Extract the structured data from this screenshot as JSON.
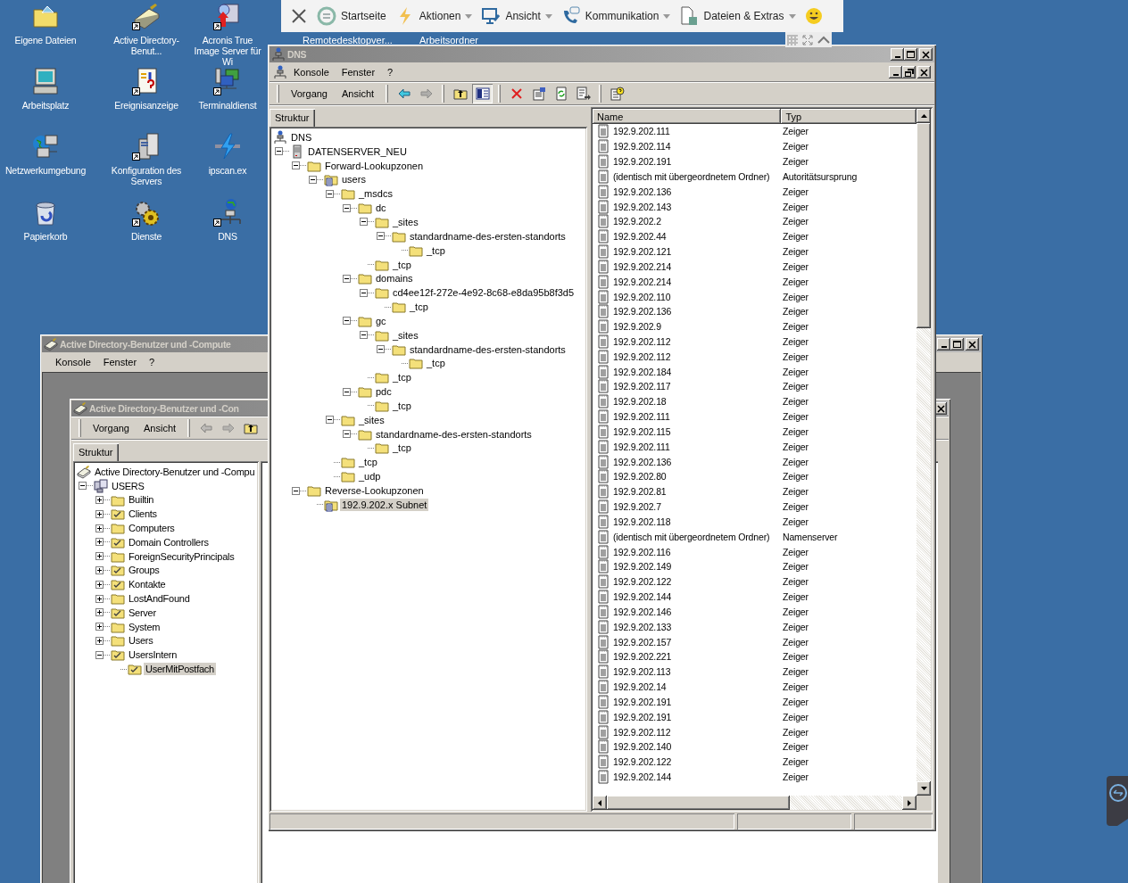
{
  "desktop_icons": [
    {
      "label": "Eigene Dateien",
      "kind": "documents",
      "shortcut": false
    },
    {
      "label": "Active Directory-Benut...",
      "kind": "directory",
      "shortcut": true
    },
    {
      "label": "Acronis True Image Server für Wi",
      "kind": "installer",
      "shortcut": true
    },
    {
      "label": "Arbeitsplatz",
      "kind": "computer",
      "shortcut": false
    },
    {
      "label": "Ereignisanzeige",
      "kind": "log",
      "shortcut": true
    },
    {
      "label": "Terminaldienst",
      "kind": "terminal",
      "shortcut": true
    },
    {
      "label": "Netzwerkumgebung",
      "kind": "network",
      "shortcut": false
    },
    {
      "label": "Konfiguration des Servers",
      "kind": "server",
      "shortcut": true
    },
    {
      "label": "ipscan.ex",
      "kind": "scanner",
      "shortcut": false
    },
    {
      "label": "Papierkorb",
      "kind": "trash",
      "shortcut": false
    },
    {
      "label": "Dienste",
      "kind": "gears",
      "shortcut": true
    },
    {
      "label": "DNS",
      "kind": "dns",
      "shortcut": true
    }
  ],
  "desktop_partial_labels": [
    "Remotedesktopver...",
    "Arbeitsordner"
  ],
  "remote_toolbar": {
    "items": [
      {
        "label": "Startseite",
        "kind": "home",
        "dropdown": false
      },
      {
        "label": "Aktionen",
        "kind": "bolt",
        "dropdown": true
      },
      {
        "label": "Ansicht",
        "kind": "monitor",
        "dropdown": true
      },
      {
        "label": "Kommunikation",
        "kind": "phone",
        "dropdown": true
      },
      {
        "label": "Dateien & Extras",
        "kind": "files",
        "dropdown": true
      }
    ]
  },
  "ad_window": {
    "title": "Active Directory-Benutzer und -Compute",
    "menu": [
      "Konsole",
      "Fenster",
      "?"
    ],
    "child": {
      "title": "Active Directory-Benutzer und -Con",
      "toolbar_menus": [
        "Vorgang",
        "Ansicht"
      ],
      "buttons": [
        {
          "kind": "back",
          "disabled": true
        },
        {
          "kind": "forward",
          "disabled": true
        },
        {
          "kind": "up",
          "disabled": false
        }
      ],
      "tab": "Struktur",
      "tree": [
        {
          "label": "Active Directory-Benutzer und -Compu",
          "kind": "directory",
          "selected": false,
          "children": [
            {
              "label": "USERS",
              "kind": "domain",
              "expanded": true,
              "selected": false,
              "children": [
                {
                  "label": "Builtin",
                  "kind": "folder",
                  "expanded": false,
                  "selected": false
                },
                {
                  "label": "Clients",
                  "kind": "ou",
                  "expanded": false,
                  "selected": false
                },
                {
                  "label": "Computers",
                  "kind": "folder",
                  "expanded": false,
                  "selected": false
                },
                {
                  "label": "Domain Controllers",
                  "kind": "ou",
                  "expanded": false,
                  "selected": false
                },
                {
                  "label": "ForeignSecurityPrincipals",
                  "kind": "folder",
                  "expanded": false,
                  "selected": false
                },
                {
                  "label": "Groups",
                  "kind": "ou",
                  "expanded": false,
                  "selected": false
                },
                {
                  "label": "Kontakte",
                  "kind": "ou",
                  "expanded": false,
                  "selected": false
                },
                {
                  "label": "LostAndFound",
                  "kind": "folder",
                  "expanded": false,
                  "selected": false
                },
                {
                  "label": "Server",
                  "kind": "ou",
                  "expanded": false,
                  "selected": false
                },
                {
                  "label": "System",
                  "kind": "folder",
                  "expanded": false,
                  "selected": false
                },
                {
                  "label": "Users",
                  "kind": "folder",
                  "expanded": false,
                  "selected": false
                },
                {
                  "label": "UsersIntern",
                  "kind": "ou",
                  "expanded": true,
                  "selected": false,
                  "children": [
                    {
                      "label": "UserMitPostfach",
                      "kind": "ou",
                      "selected": true
                    }
                  ]
                }
              ]
            }
          ]
        }
      ]
    }
  },
  "dns_window": {
    "title": "DNS",
    "menu": [
      "Konsole",
      "Fenster",
      "?"
    ],
    "toolbar_menus": [
      "Vorgang",
      "Ansicht"
    ],
    "button_groups": [
      [
        {
          "kind": "back",
          "disabled": false,
          "pressed": false
        },
        {
          "kind": "forward",
          "disabled": true,
          "pressed": false
        }
      ],
      [
        {
          "kind": "up",
          "disabled": false,
          "pressed": false
        },
        {
          "kind": "tree",
          "disabled": false,
          "pressed": true
        }
      ],
      [
        {
          "kind": "delete",
          "disabled": false,
          "pressed": false
        },
        {
          "kind": "properties",
          "disabled": false,
          "pressed": false
        },
        {
          "kind": "refresh",
          "disabled": false,
          "pressed": false
        },
        {
          "kind": "export",
          "disabled": false,
          "pressed": false
        }
      ],
      [
        {
          "kind": "help",
          "disabled": false,
          "pressed": false
        }
      ]
    ],
    "tab": "Struktur",
    "tree": [
      {
        "label": "DNS",
        "kind": "dns",
        "selected": false,
        "children": [
          {
            "label": "DATENSERVER_NEU",
            "kind": "server",
            "expanded": true,
            "selected": false,
            "children": [
              {
                "label": "Forward-Lookupzonen",
                "kind": "folder",
                "expanded": true,
                "selected": false,
                "children": [
                  {
                    "label": "users",
                    "kind": "zone",
                    "expanded": true,
                    "selected": false,
                    "children": [
                      {
                        "label": "_msdcs",
                        "kind": "folder",
                        "expanded": true,
                        "selected": false,
                        "children": [
                          {
                            "label": "dc",
                            "kind": "folder",
                            "expanded": true,
                            "selected": false,
                            "children": [
                              {
                                "label": "_sites",
                                "kind": "folder",
                                "expanded": true,
                                "selected": false,
                                "children": [
                                  {
                                    "label": "standardname-des-ersten-standorts",
                                    "kind": "folder",
                                    "expanded": true,
                                    "selected": false,
                                    "children": [
                                      {
                                        "label": "_tcp",
                                        "kind": "folder",
                                        "selected": false
                                      }
                                    ]
                                  }
                                ]
                              },
                              {
                                "label": "_tcp",
                                "kind": "folder",
                                "selected": false
                              }
                            ]
                          },
                          {
                            "label": "domains",
                            "kind": "folder",
                            "expanded": true,
                            "selected": false,
                            "children": [
                              {
                                "label": "cd4ee12f-272e-4e92-8c68-e8da95b8f3d5",
                                "kind": "folder",
                                "expanded": true,
                                "selected": false,
                                "children": [
                                  {
                                    "label": "_tcp",
                                    "kind": "folder",
                                    "selected": false
                                  }
                                ]
                              }
                            ]
                          },
                          {
                            "label": "gc",
                            "kind": "folder",
                            "expanded": true,
                            "selected": false,
                            "children": [
                              {
                                "label": "_sites",
                                "kind": "folder",
                                "expanded": true,
                                "selected": false,
                                "children": [
                                  {
                                    "label": "standardname-des-ersten-standorts",
                                    "kind": "folder",
                                    "expanded": true,
                                    "selected": false,
                                    "children": [
                                      {
                                        "label": "_tcp",
                                        "kind": "folder",
                                        "selected": false
                                      }
                                    ]
                                  }
                                ]
                              },
                              {
                                "label": "_tcp",
                                "kind": "folder",
                                "selected": false
                              }
                            ]
                          },
                          {
                            "label": "pdc",
                            "kind": "folder",
                            "expanded": true,
                            "selected": false,
                            "children": [
                              {
                                "label": "_tcp",
                                "kind": "folder",
                                "selected": false
                              }
                            ]
                          }
                        ]
                      },
                      {
                        "label": "_sites",
                        "kind": "folder",
                        "expanded": true,
                        "selected": false,
                        "children": [
                          {
                            "label": "standardname-des-ersten-standorts",
                            "kind": "folder",
                            "expanded": true,
                            "selected": false,
                            "children": [
                              {
                                "label": "_tcp",
                                "kind": "folder",
                                "selected": false
                              }
                            ]
                          }
                        ]
                      },
                      {
                        "label": "_tcp",
                        "kind": "folder",
                        "selected": false
                      },
                      {
                        "label": "_udp",
                        "kind": "folder",
                        "selected": false
                      }
                    ]
                  }
                ]
              },
              {
                "label": "Reverse-Lookupzonen",
                "kind": "folder",
                "expanded": true,
                "selected": false,
                "children": [
                  {
                    "label": "192.9.202.x Subnet",
                    "kind": "zone",
                    "selected": true
                  }
                ]
              }
            ]
          }
        ]
      }
    ],
    "list": {
      "columns": [
        "Name",
        "Typ"
      ],
      "rows": [
        {
          "name": "192.9.202.111",
          "type": "Zeiger"
        },
        {
          "name": "192.9.202.114",
          "type": "Zeiger"
        },
        {
          "name": "192.9.202.191",
          "type": "Zeiger"
        },
        {
          "name": "(identisch mit übergeordnetem Ordner)",
          "type": "Autoritätsursprung"
        },
        {
          "name": "192.9.202.136",
          "type": "Zeiger"
        },
        {
          "name": "192.9.202.143",
          "type": "Zeiger"
        },
        {
          "name": "192.9.202.2",
          "type": "Zeiger"
        },
        {
          "name": "192.9.202.44",
          "type": "Zeiger"
        },
        {
          "name": "192.9.202.121",
          "type": "Zeiger"
        },
        {
          "name": "192.9.202.214",
          "type": "Zeiger"
        },
        {
          "name": "192.9.202.214",
          "type": "Zeiger"
        },
        {
          "name": "192.9.202.110",
          "type": "Zeiger"
        },
        {
          "name": "192.9.202.136",
          "type": "Zeiger"
        },
        {
          "name": "192.9.202.9",
          "type": "Zeiger"
        },
        {
          "name": "192.9.202.112",
          "type": "Zeiger"
        },
        {
          "name": "192.9.202.112",
          "type": "Zeiger"
        },
        {
          "name": "192.9.202.184",
          "type": "Zeiger"
        },
        {
          "name": "192.9.202.117",
          "type": "Zeiger"
        },
        {
          "name": "192.9.202.18",
          "type": "Zeiger"
        },
        {
          "name": "192.9.202.111",
          "type": "Zeiger"
        },
        {
          "name": "192.9.202.115",
          "type": "Zeiger"
        },
        {
          "name": "192.9.202.111",
          "type": "Zeiger"
        },
        {
          "name": "192.9.202.136",
          "type": "Zeiger"
        },
        {
          "name": "192.9.202.80",
          "type": "Zeiger"
        },
        {
          "name": "192.9.202.81",
          "type": "Zeiger"
        },
        {
          "name": "192.9.202.7",
          "type": "Zeiger"
        },
        {
          "name": "192.9.202.118",
          "type": "Zeiger"
        },
        {
          "name": "(identisch mit übergeordnetem Ordner)",
          "type": "Namenserver"
        },
        {
          "name": "192.9.202.116",
          "type": "Zeiger"
        },
        {
          "name": "192.9.202.149",
          "type": "Zeiger"
        },
        {
          "name": "192.9.202.122",
          "type": "Zeiger"
        },
        {
          "name": "192.9.202.144",
          "type": "Zeiger"
        },
        {
          "name": "192.9.202.146",
          "type": "Zeiger"
        },
        {
          "name": "192.9.202.133",
          "type": "Zeiger"
        },
        {
          "name": "192.9.202.157",
          "type": "Zeiger"
        },
        {
          "name": "192.9.202.221",
          "type": "Zeiger"
        },
        {
          "name": "192.9.202.113",
          "type": "Zeiger"
        },
        {
          "name": "192.9.202.14",
          "type": "Zeiger"
        },
        {
          "name": "192.9.202.191",
          "type": "Zeiger"
        },
        {
          "name": "192.9.202.191",
          "type": "Zeiger"
        },
        {
          "name": "192.9.202.112",
          "type": "Zeiger"
        },
        {
          "name": "192.9.202.140",
          "type": "Zeiger"
        },
        {
          "name": "192.9.202.122",
          "type": "Zeiger"
        },
        {
          "name": "192.9.202.144",
          "type": "Zeiger"
        }
      ]
    }
  }
}
